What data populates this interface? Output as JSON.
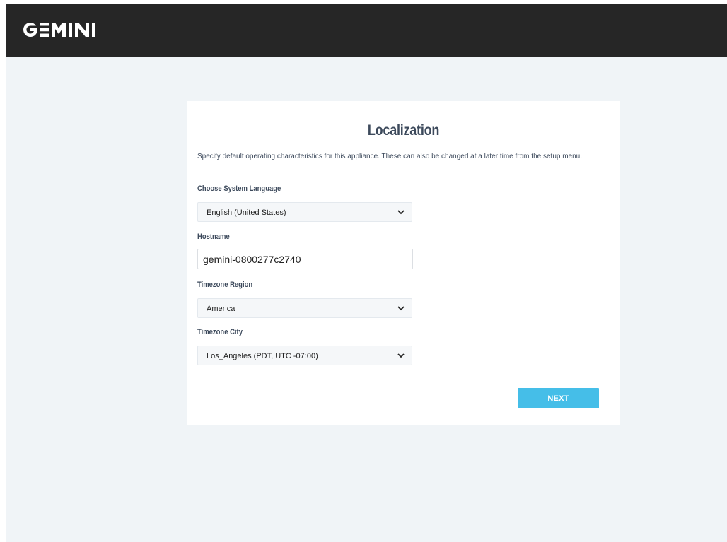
{
  "header": {
    "logo_text": "GEMINI",
    "background": "#262626"
  },
  "page": {
    "title": "Localization",
    "description": "Specify default operating characteristics for this appliance. These can also be changed at a later time from the setup menu."
  },
  "fields": {
    "language": {
      "label": "Choose System Language",
      "value": "English (United States)"
    },
    "hostname": {
      "label": "Hostname",
      "value": "gemini-0800277c2740"
    },
    "timezone_region": {
      "label": "Timezone Region",
      "value": "America"
    },
    "timezone_city": {
      "label": "Timezone City",
      "value": "Los_Angeles (PDT, UTC -07:00)"
    }
  },
  "actions": {
    "next_label": "NEXT",
    "accent_color": "#45bee8"
  },
  "icons": {
    "select_chevron": "chevron-down-icon"
  }
}
